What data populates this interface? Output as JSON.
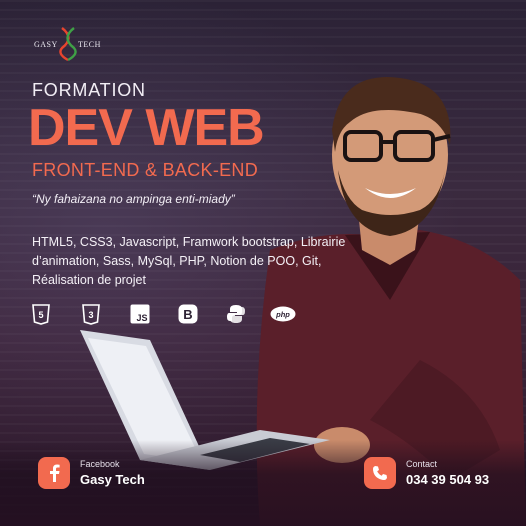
{
  "logo": {
    "left_text": "GASY",
    "right_text": "TECH",
    "icon": "dna-helix-icon"
  },
  "headline": {
    "formation": "FORMATION",
    "title": "DEV WEB",
    "subtitle": "FRONT-END & BACK-END"
  },
  "quote": "“Ny fahaizana no ampinga enti-miady”",
  "technologies": "HTML5, CSS3, Javascript, Framwork bootstrap, Librairie d’animation, Sass, MySql, PHP, Notion de POO, Git, Réalisation de projet",
  "tech_icons": [
    {
      "name": "html5-icon",
      "text": "5"
    },
    {
      "name": "css3-icon",
      "text": "3"
    },
    {
      "name": "javascript-icon",
      "text": "JS"
    },
    {
      "name": "bootstrap-icon",
      "text": "B"
    },
    {
      "name": "python-icon",
      "text": ""
    },
    {
      "name": "php-icon",
      "text": "php"
    }
  ],
  "facebook": {
    "icon": "facebook-icon",
    "label": "Facebook",
    "value": "Gasy Tech"
  },
  "contact": {
    "icon": "phone-icon",
    "label": "Contact",
    "value": "034 39 504 93"
  },
  "colors": {
    "accent": "#f26a4f",
    "background": "#2e2335",
    "text": "#f4f0f6"
  }
}
